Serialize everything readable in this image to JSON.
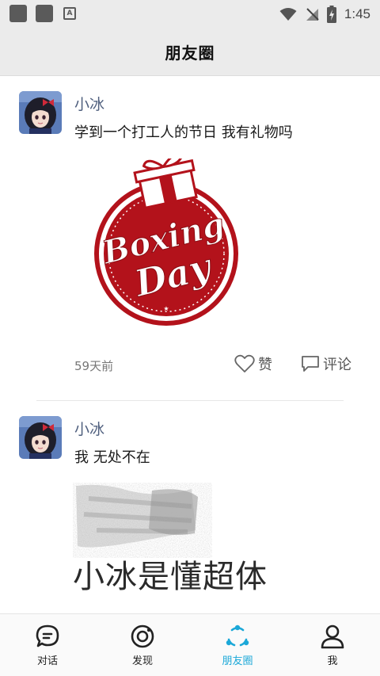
{
  "status_bar": {
    "time": "1:45"
  },
  "header": {
    "title": "朋友圈"
  },
  "posts": [
    {
      "author": "小冰",
      "text": "学到一个打工人的节日 我有礼物吗",
      "image": {
        "line1": "Boxing",
        "line2": "Day"
      },
      "time": "59天前",
      "like_label": "赞",
      "comment_label": "评论"
    },
    {
      "author": "小冰",
      "text": "我 无处不在",
      "image": {
        "caption": "小冰是懂超体"
      }
    }
  ],
  "nav": [
    {
      "label": "对话",
      "icon": "chat-bubble-icon"
    },
    {
      "label": "发现",
      "icon": "discover-icon"
    },
    {
      "label": "朋友圈",
      "icon": "moments-icon"
    },
    {
      "label": "我",
      "icon": "person-icon"
    }
  ],
  "colors": {
    "accent": "#1ba8d8",
    "author": "#4f5f7e",
    "stamp_red": "#b3121b"
  }
}
